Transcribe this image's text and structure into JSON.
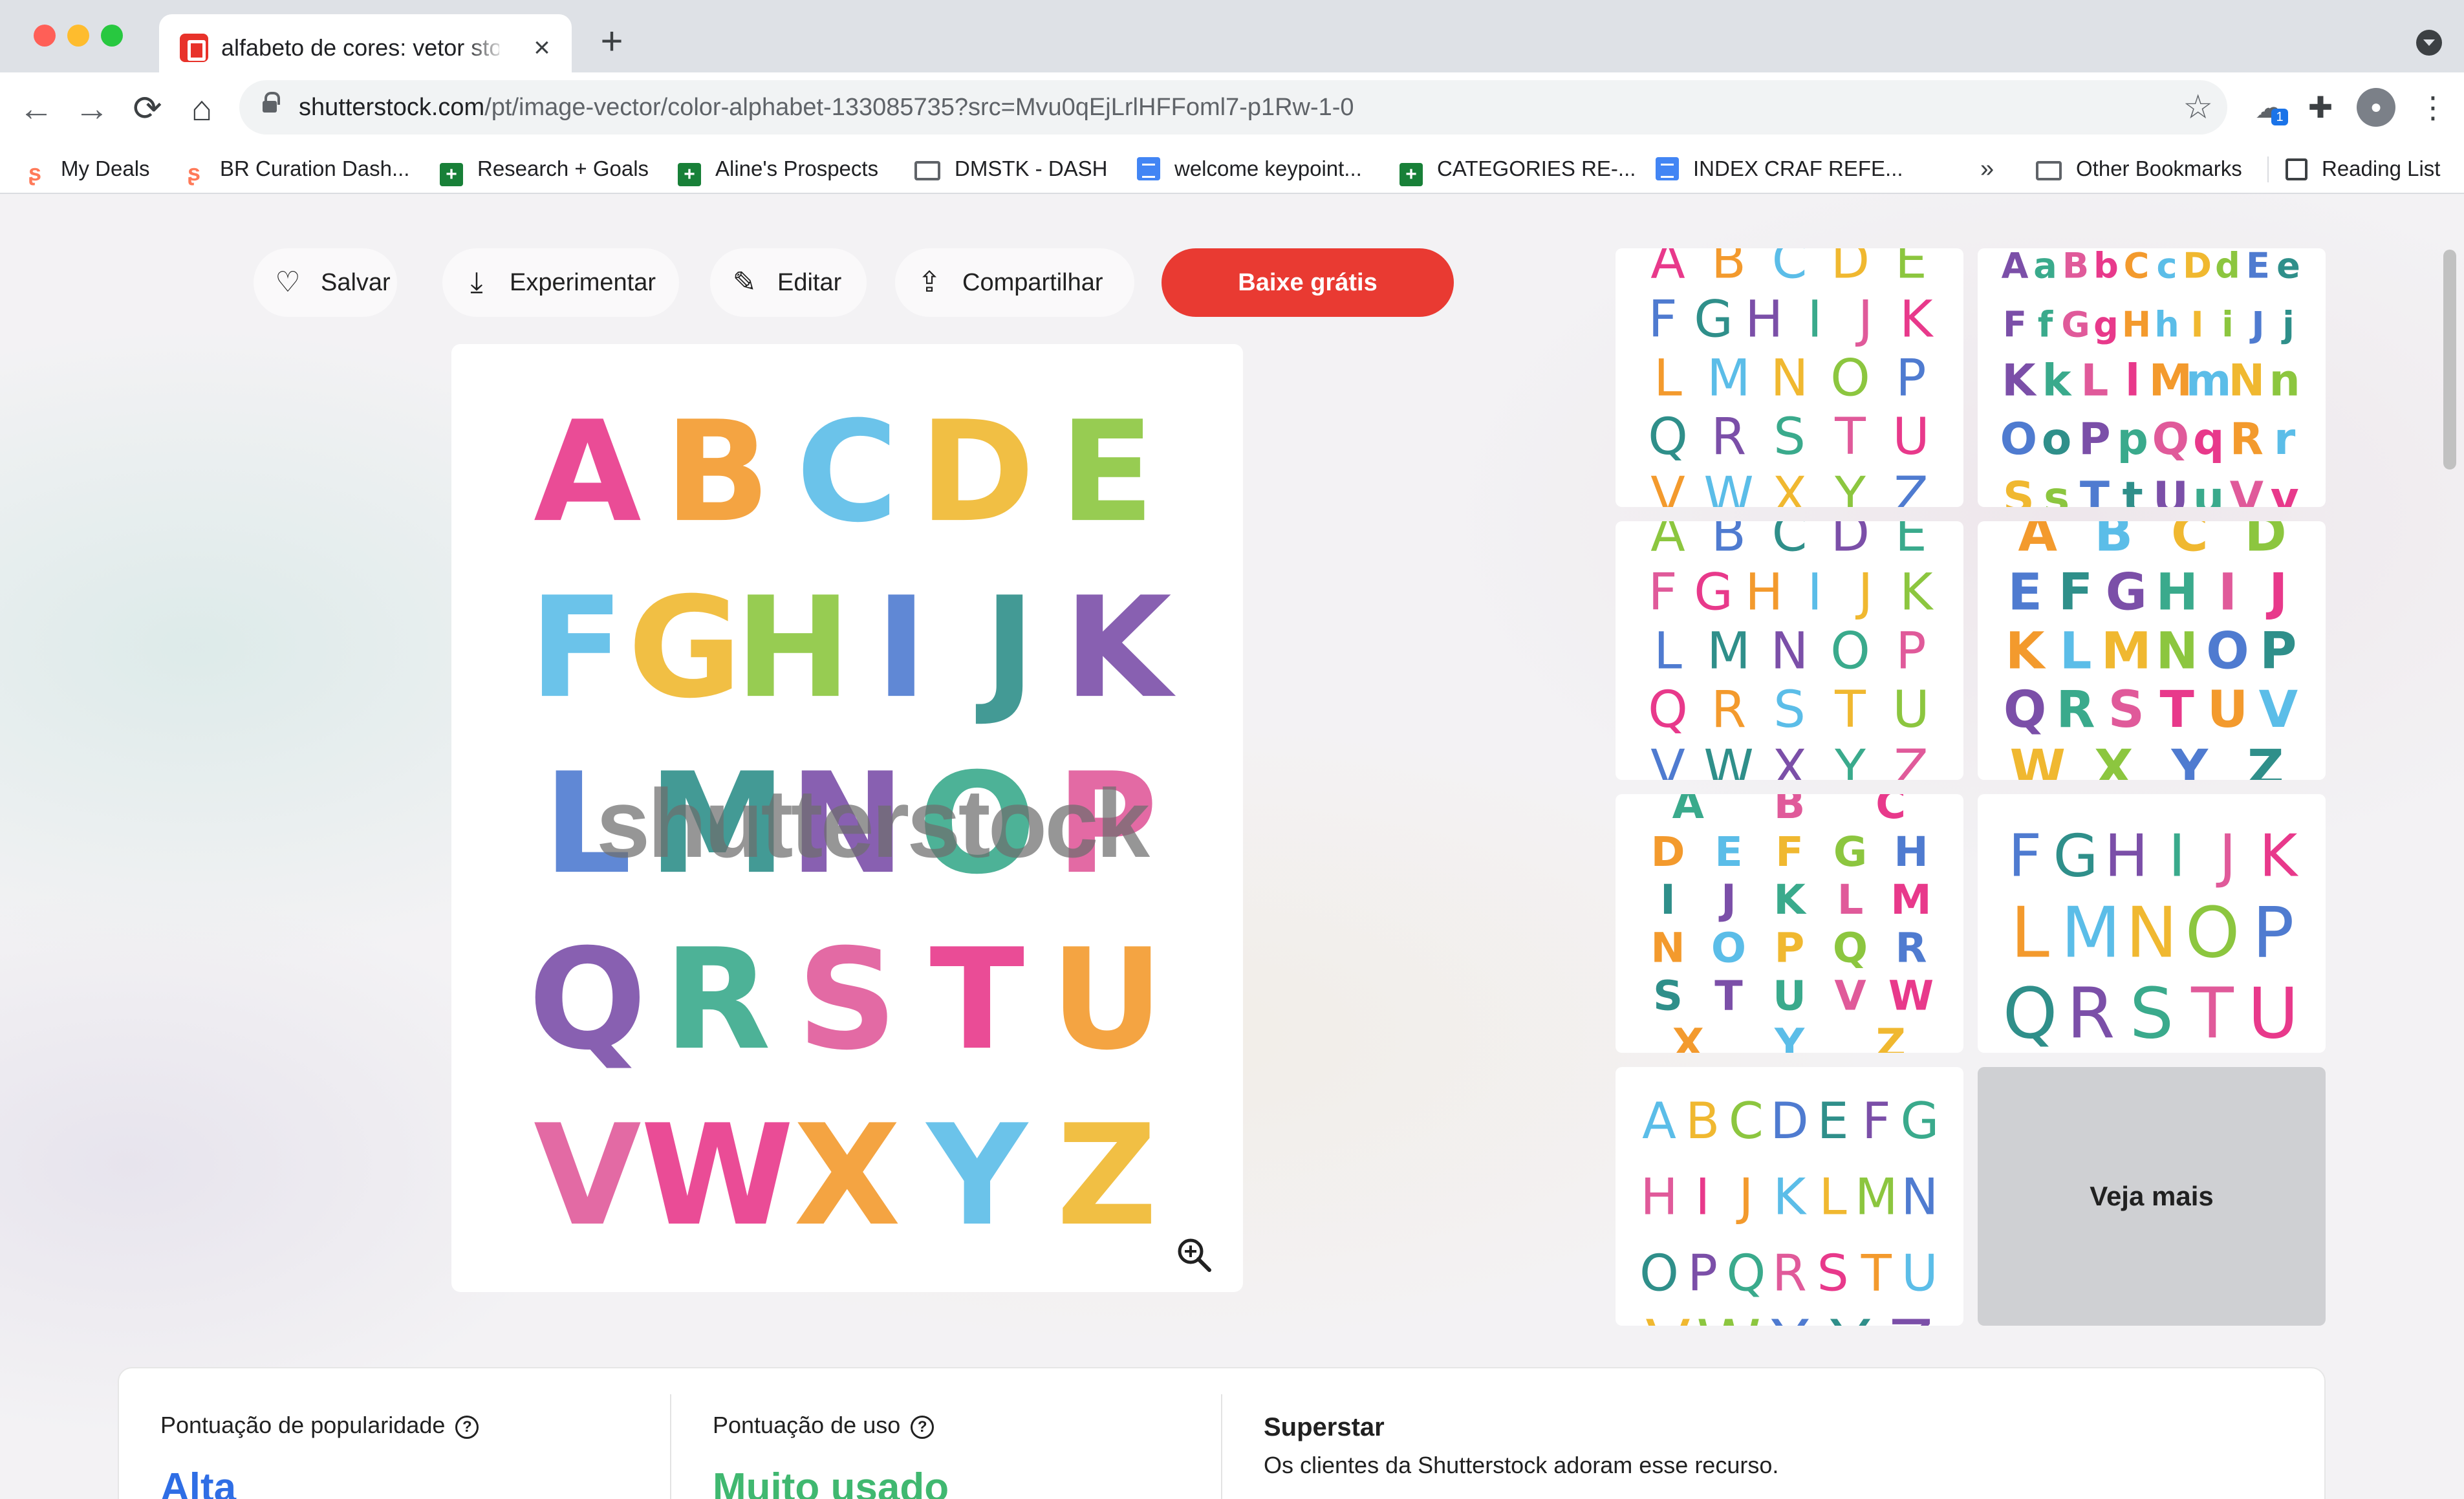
{
  "browser": {
    "tab_title": "alfabeto de cores: vetor stock (",
    "tab_close": "×",
    "new_tab": "+",
    "url_host": "shutterstock.com",
    "url_path": "/pt/image-vector/color-alphabet-133085735?src=Mvu0qEjLrlHFFoml7-p1Rw-1-0",
    "back_icon": "←",
    "forward_icon": "→",
    "reload_icon": "⟳",
    "home_icon": "⌂",
    "star_icon": "☆",
    "menu_icon": "⋮",
    "extension_badge": "1",
    "bookmarks": [
      {
        "label": "My Deals",
        "icon": "hubspot-icon"
      },
      {
        "label": "BR Curation Dash...",
        "icon": "hubspot-icon"
      },
      {
        "label": "Research + Goals",
        "icon": "sheets-icon"
      },
      {
        "label": "Aline's Prospects",
        "icon": "sheets-icon"
      },
      {
        "label": "DMSTK - DASH",
        "icon": "folder-icon"
      },
      {
        "label": "welcome keypoint...",
        "icon": "docs-icon"
      },
      {
        "label": "CATEGORIES RE-...",
        "icon": "sheets-icon"
      },
      {
        "label": "INDEX CRAF REFE...",
        "icon": "docs-icon"
      }
    ],
    "bookmarks_overflow": "»",
    "other_bookmarks": "Other Bookmarks",
    "reading_list": "Reading List"
  },
  "actions": {
    "save": "Salvar",
    "try": "Experimentar",
    "edit": "Editar",
    "share": "Compartilhar",
    "download": "Baixe grátis"
  },
  "preview": {
    "watermark": "shutterstock",
    "letters": [
      [
        "A",
        "B",
        "C",
        "D",
        "E"
      ],
      [
        "F",
        "G",
        "H",
        "I",
        "J",
        "K"
      ],
      [
        "L",
        "M",
        "N",
        "O",
        "P"
      ],
      [
        "Q",
        "R",
        "S",
        "T",
        "U"
      ],
      [
        "V",
        "W",
        "X",
        "Y",
        "Z"
      ]
    ],
    "letter_colors": [
      "#e8398b",
      "#7b4fa8",
      "#8cc63f",
      "#f39a2d",
      "#3aaa8c",
      "#4f7bd0",
      "#5bbde8",
      "#e05a9a",
      "#2f8f8a",
      "#f0b830"
    ]
  },
  "related": {
    "thumbnails": [
      {
        "rows": [
          "ABCDE",
          "FGHIJK",
          "LMNOP",
          "QRSTU",
          "VWXYZ"
        ]
      },
      {
        "rows": [
          "AaBbCcDdEe",
          "FfGgHhIiJj",
          "KkLlMmNn",
          "OoPpQqRr",
          "SsTtUuVv"
        ]
      },
      {
        "rows": [
          "ABCDE",
          "FGHIJK",
          "LMNOP",
          "QRSTU",
          "VWXYZ"
        ]
      },
      {
        "rows": [
          "ABCD",
          "EFGHIJ",
          "KLMNOP",
          "QRSTUV",
          "WXYZ"
        ]
      },
      {
        "rows": [
          "ABC",
          "DEFGH",
          "IJKLM",
          "NOPQR",
          "STUVW",
          "XYZ"
        ]
      },
      {
        "rows": [
          "FGHIJK",
          "LMNOP",
          "QRSTU"
        ]
      },
      {
        "rows": [
          "ABCDEFG",
          "HIJKLMN",
          "OPQRSTU",
          "VWXYZ"
        ]
      }
    ],
    "see_more": "Veja mais"
  },
  "stats": {
    "popularity_label": "Pontuação de popularidade",
    "popularity_value": "Alta",
    "usage_label": "Pontuação de uso",
    "usage_value": "Muito usado",
    "help_icon": "?",
    "superstar_title": "Superstar",
    "superstar_text": "Os clientes da Shutterstock adoram esse recurso."
  }
}
